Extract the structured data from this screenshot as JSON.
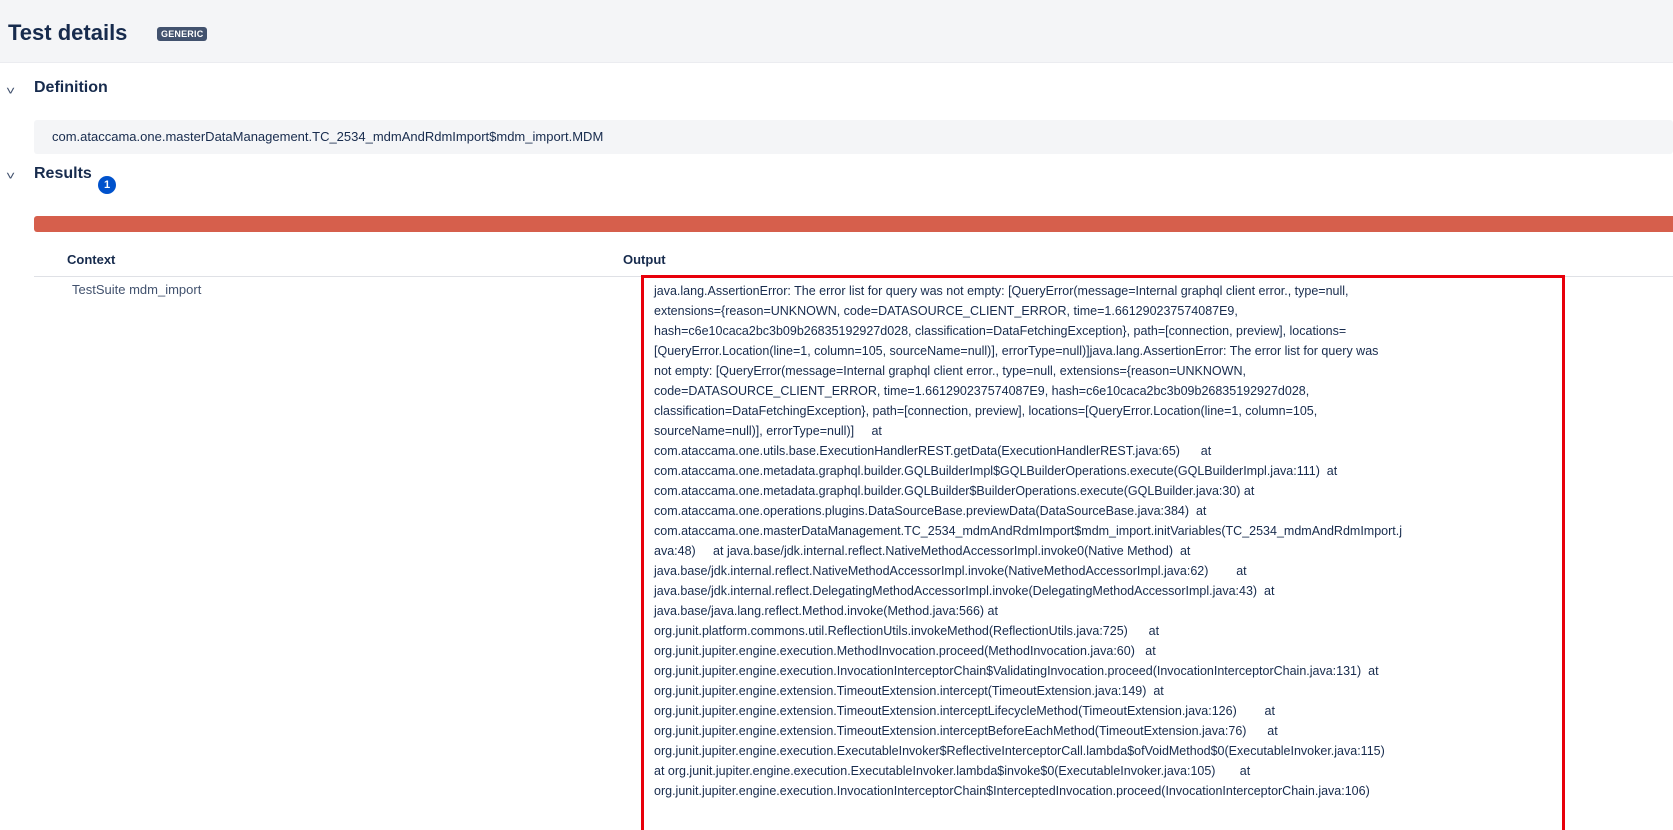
{
  "header": {
    "title": "Test details",
    "type_badge": "GENERIC"
  },
  "definition": {
    "section_title": "Definition",
    "toggle_icon": "chevron-down-icon",
    "value": "com.ataccama.one.masterDataManagement.TC_2534_mdmAndRdmImport$mdm_import.MDM"
  },
  "results": {
    "section_title": "Results",
    "toggle_icon": "chevron-down-icon",
    "count": "1",
    "status_color": "#d65f4c",
    "table": {
      "columns": [
        "Context",
        "Output"
      ],
      "rows": [
        {
          "context": "TestSuite mdm_import",
          "output_lines": [
            "java.lang.AssertionError: The error list for query was not empty: [QueryError(message=Internal graphql client error., type=null,",
            "extensions={reason=UNKNOWN, code=DATASOURCE_CLIENT_ERROR, time=1.661290237574087E9,",
            "hash=c6e10caca2bc3b09b26835192927d028, classification=DataFetchingException}, path=[connection, preview], locations=",
            "[QueryError.Location(line=1, column=105, sourceName=null)], errorType=null)]java.lang.AssertionError: The error list for query was",
            "not empty: [QueryError(message=Internal graphql client error., type=null, extensions={reason=UNKNOWN,",
            "code=DATASOURCE_CLIENT_ERROR, time=1.661290237574087E9, hash=c6e10caca2bc3b09b26835192927d028,",
            "classification=DataFetchingException}, path=[connection, preview], locations=[QueryError.Location(line=1, column=105,",
            "sourceName=null)], errorType=null)]     at",
            "com.ataccama.one.utils.base.ExecutionHandlerREST.getData(ExecutionHandlerREST.java:65)      at",
            "com.ataccama.one.metadata.graphql.builder.GQLBuilderImpl$GQLBuilderOperations.execute(GQLBuilderImpl.java:111)  at",
            "com.ataccama.one.metadata.graphql.builder.GQLBuilder$BuilderOperations.execute(GQLBuilder.java:30) at",
            "com.ataccama.one.operations.plugins.DataSourceBase.previewData(DataSourceBase.java:384)  at",
            "com.ataccama.one.masterDataManagement.TC_2534_mdmAndRdmImport$mdm_import.initVariables(TC_2534_mdmAndRdmImport.j",
            "ava:48)     at java.base/jdk.internal.reflect.NativeMethodAccessorImpl.invoke0(Native Method)  at",
            "java.base/jdk.internal.reflect.NativeMethodAccessorImpl.invoke(NativeMethodAccessorImpl.java:62)        at",
            "java.base/jdk.internal.reflect.DelegatingMethodAccessorImpl.invoke(DelegatingMethodAccessorImpl.java:43)  at",
            "java.base/java.lang.reflect.Method.invoke(Method.java:566) at",
            "org.junit.platform.commons.util.ReflectionUtils.invokeMethod(ReflectionUtils.java:725)      at",
            "org.junit.jupiter.engine.execution.MethodInvocation.proceed(MethodInvocation.java:60)   at",
            "org.junit.jupiter.engine.execution.InvocationInterceptorChain$ValidatingInvocation.proceed(InvocationInterceptorChain.java:131)  at",
            "org.junit.jupiter.engine.extension.TimeoutExtension.intercept(TimeoutExtension.java:149)  at",
            "org.junit.jupiter.engine.extension.TimeoutExtension.interceptLifecycleMethod(TimeoutExtension.java:126)        at",
            "org.junit.jupiter.engine.extension.TimeoutExtension.interceptBeforeEachMethod(TimeoutExtension.java:76)      at",
            "org.junit.jupiter.engine.execution.ExecutableInvoker$ReflectiveInterceptorCall.lambda$ofVoidMethod$0(ExecutableInvoker.java:115)",
            "at org.junit.jupiter.engine.execution.ExecutableInvoker.lambda$invoke$0(ExecutableInvoker.java:105)       at",
            "org.junit.jupiter.engine.execution.InvocationInterceptorChain$InterceptedInvocation.proceed(InvocationInterceptorChain.java:106)"
          ]
        }
      ]
    }
  }
}
